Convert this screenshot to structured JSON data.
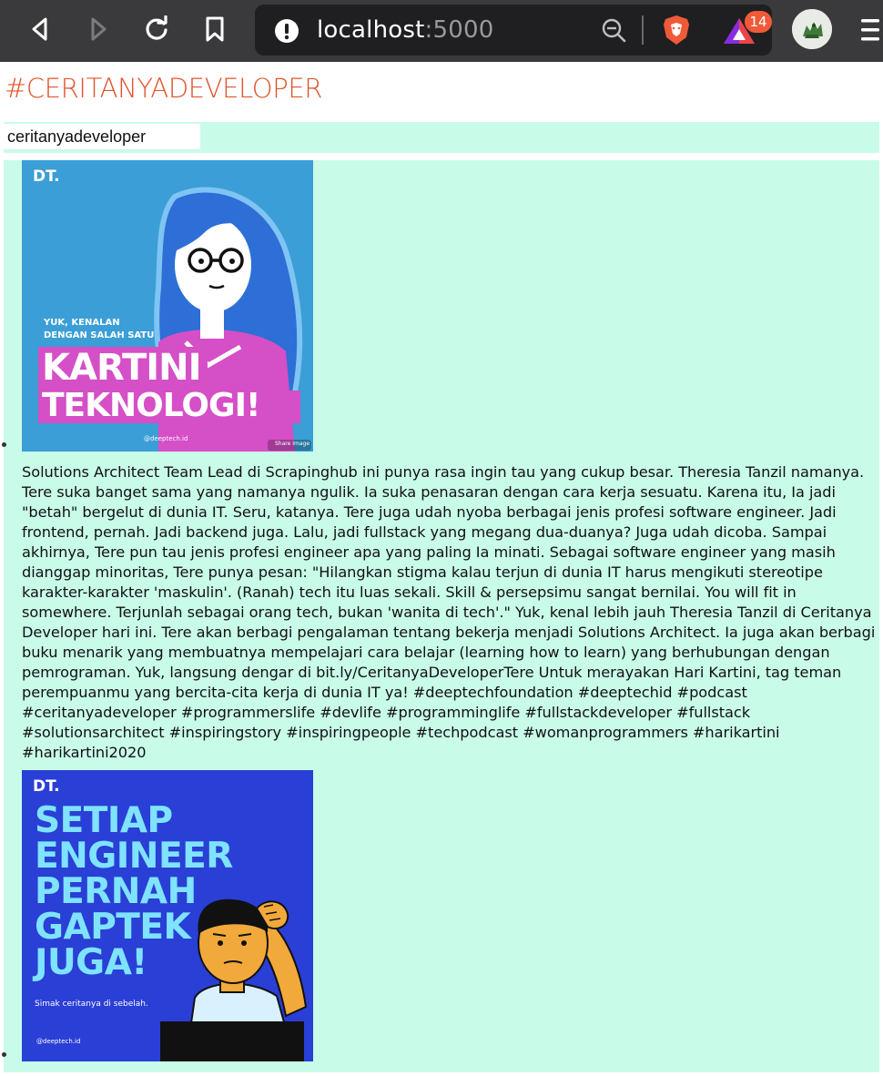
{
  "browser": {
    "url_host": "localhost",
    "url_port": ":5000",
    "shield_badge_count": "14",
    "icons": [
      "back-icon",
      "forward-icon",
      "reload-icon",
      "bookmark-icon",
      "site-info-icon",
      "zoom-out-icon",
      "brave-shields-icon",
      "brave-rewards-icon",
      "profile-avatar",
      "menu-icon"
    ]
  },
  "page": {
    "title": "#CERITANYADEVELOPER",
    "search_value": "ceritanyadeveloper"
  },
  "posts": [
    {
      "image": {
        "logo": "DT.",
        "kicker_line1": "YUK, KENALAN",
        "kicker_line2": "DENGAN SALAH SATU",
        "headline_line1": "KARTINI",
        "headline_line2": "TEKNOLOGI!",
        "handle": "@deeptech.id",
        "share_label": "Share Image",
        "bg_color": "#3b9ed6",
        "accent_color": "#d54fc6"
      },
      "caption": "Solutions Architect Team Lead di Scrapinghub ini punya rasa ingin tau yang cukup besar. Theresia Tanzil namanya.  Tere suka banget sama yang namanya ngulik. Ia suka penasaran dengan cara kerja sesuatu. Karena itu, Ia jadi \"betah\" bergelut di dunia IT. Seru, katanya.  Tere juga udah nyoba berbagai jenis profesi software engineer. Jadi frontend, pernah. Jadi backend juga. Lalu, jadi fullstack yang megang dua-duanya? Juga udah dicoba. Sampai akhirnya, Tere pun tau jenis profesi engineer apa yang paling Ia minati.  Sebagai software engineer yang masih dianggap minoritas, Tere punya pesan:  \"Hilangkan stigma kalau terjun di dunia IT harus mengikuti stereotipe karakter-karakter 'maskulin'. (Ranah) tech itu luas sekali. Skill & persepsimu sangat bernilai. You will fit in somewhere. Terjunlah sebagai orang tech, bukan 'wanita di tech'.\"  Yuk, kenal lebih jauh Theresia Tanzil di Ceritanya Developer hari ini.  Tere akan berbagi pengalaman tentang bekerja menjadi Solutions Architect. Ia juga akan berbagi buku menarik yang membuatnya mempelajari cara belajar (learning how to learn) yang berhubungan dengan pemrograman.  Yuk, langsung dengar di bit.ly/CeritanyaDeveloperTere  Untuk merayakan Hari Kartini, tag teman perempuanmu yang bercita-cita kerja di dunia IT ya!  #deeptechfoundation #deeptechid #podcast #ceritanyadeveloper #programmerslife #devlife #programminglife #fullstackdeveloper #fullstack #solutionsarchitect #inspiringstory #inspiringpeople #techpodcast #womanprogrammers #harikartini #harikartini2020"
    },
    {
      "image": {
        "logo": "DT.",
        "headline_line1": "SETIAP",
        "headline_line2": "ENGINEER",
        "headline_line3": "PERNAH",
        "headline_line4": "GAPTEK",
        "headline_line5": "JUGA!",
        "subtext": "Simak ceritanya di sebelah.",
        "handle": "@deeptech.id",
        "bg_color": "#2a3fd6",
        "accent_color": "#7fe3ff"
      }
    }
  ]
}
